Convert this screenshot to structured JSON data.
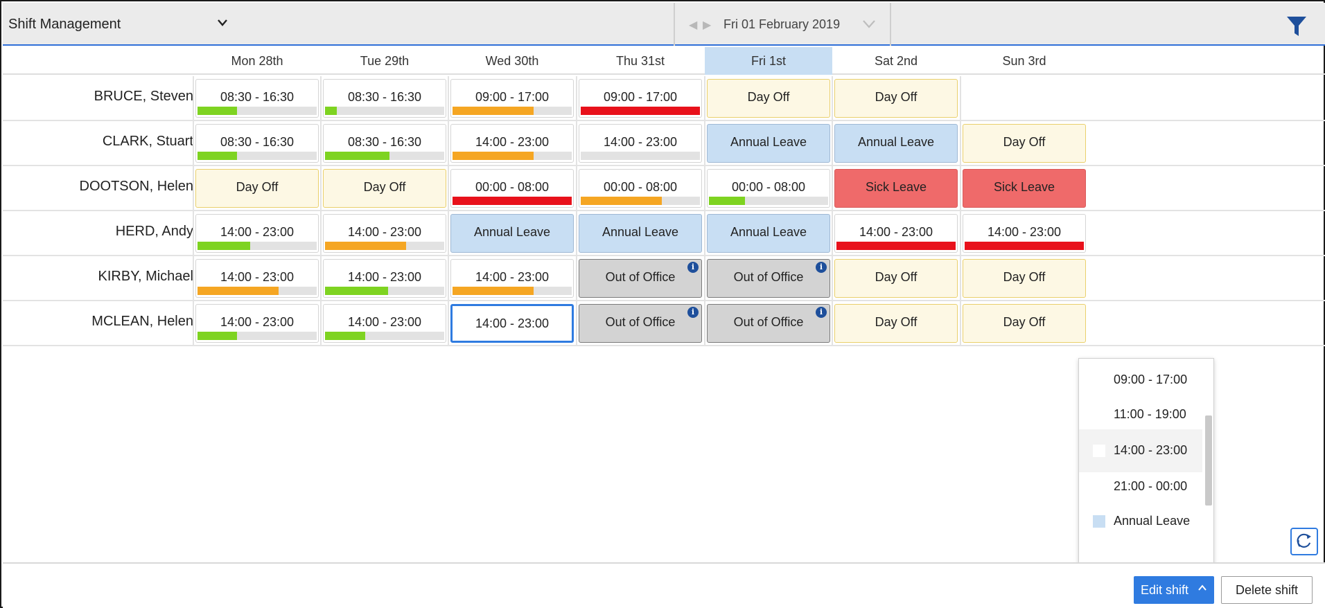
{
  "header": {
    "app_title": "Shift Management",
    "date": "Fri 01 February 2019"
  },
  "colors": {
    "accent": "#2f7be0",
    "dayoff_bg": "#fdf8e4",
    "annual_bg": "#c8def3",
    "sick_bg": "#ef6a6a",
    "ooo_bg": "#d3d3d3",
    "progress_green": "#7ed321",
    "progress_orange": "#f5a623",
    "progress_red": "#e8111b"
  },
  "days": [
    "Mon 28th",
    "Tue 29th",
    "Wed 30th",
    "Thu 31st",
    "Fri 1st",
    "Sat 2nd",
    "Sun 3rd"
  ],
  "today_index": 4,
  "rows": [
    {
      "name": "BRUCE, Steven",
      "cells": [
        {
          "type": "shift",
          "label": "08:30 - 16:30",
          "progress": 0.33,
          "color": "green"
        },
        {
          "type": "shift",
          "label": "08:30 - 16:30",
          "progress": 0.1,
          "color": "green"
        },
        {
          "type": "shift",
          "label": "09:00 - 17:00",
          "progress": 0.68,
          "color": "orange"
        },
        {
          "type": "shift",
          "label": "09:00 - 17:00",
          "progress": 1.0,
          "color": "red"
        },
        {
          "type": "dayoff",
          "label": "Day Off"
        },
        {
          "type": "dayoff",
          "label": "Day Off"
        },
        {
          "type": "empty",
          "label": ""
        }
      ]
    },
    {
      "name": "CLARK, Stuart",
      "cells": [
        {
          "type": "shift",
          "label": "08:30 - 16:30",
          "progress": 0.33,
          "color": "green"
        },
        {
          "type": "shift",
          "label": "08:30 - 16:30",
          "progress": 0.54,
          "color": "green"
        },
        {
          "type": "shift",
          "label": "14:00 - 23:00",
          "progress": 0.68,
          "color": "orange"
        },
        {
          "type": "shift",
          "label": "14:00 - 23:00",
          "progress": 0.0,
          "color": "green"
        },
        {
          "type": "annual",
          "label": "Annual Leave"
        },
        {
          "type": "annual",
          "label": "Annual Leave"
        },
        {
          "type": "dayoff",
          "label": "Day Off"
        }
      ]
    },
    {
      "name": "DOOTSON, Helen",
      "cells": [
        {
          "type": "dayoff",
          "label": "Day Off"
        },
        {
          "type": "dayoff",
          "label": "Day Off"
        },
        {
          "type": "shift",
          "label": "00:00 - 08:00",
          "progress": 1.0,
          "color": "red"
        },
        {
          "type": "shift",
          "label": "00:00 - 08:00",
          "progress": 0.68,
          "color": "orange"
        },
        {
          "type": "shift",
          "label": "00:00 - 08:00",
          "progress": 0.3,
          "color": "green"
        },
        {
          "type": "sick",
          "label": "Sick Leave"
        },
        {
          "type": "sick",
          "label": "Sick Leave"
        }
      ]
    },
    {
      "name": "HERD, Andy",
      "cells": [
        {
          "type": "shift",
          "label": "14:00 - 23:00",
          "progress": 0.44,
          "color": "green"
        },
        {
          "type": "shift",
          "label": "14:00 - 23:00",
          "progress": 0.68,
          "color": "orange"
        },
        {
          "type": "annual",
          "label": "Annual Leave"
        },
        {
          "type": "annual",
          "label": "Annual Leave"
        },
        {
          "type": "annual",
          "label": "Annual Leave"
        },
        {
          "type": "shift",
          "label": "14:00 - 23:00",
          "progress": 1.0,
          "color": "red"
        },
        {
          "type": "shift",
          "label": "14:00 - 23:00",
          "progress": 1.0,
          "color": "red"
        }
      ]
    },
    {
      "name": "KIRBY, Michael",
      "cells": [
        {
          "type": "shift",
          "label": "14:00 - 23:00",
          "progress": 0.68,
          "color": "orange"
        },
        {
          "type": "shift",
          "label": "14:00 - 23:00",
          "progress": 0.53,
          "color": "green"
        },
        {
          "type": "shift",
          "label": "14:00 - 23:00",
          "progress": 0.68,
          "color": "orange"
        },
        {
          "type": "ooo",
          "label": "Out of Office",
          "info": "i"
        },
        {
          "type": "ooo",
          "label": "Out of Office",
          "info": "i"
        },
        {
          "type": "dayoff",
          "label": "Day Off"
        },
        {
          "type": "dayoff",
          "label": "Day Off"
        }
      ]
    },
    {
      "name": "MCLEAN, Helen",
      "cells": [
        {
          "type": "shift",
          "label": "14:00 - 23:00",
          "progress": 0.33,
          "color": "green"
        },
        {
          "type": "shift",
          "label": "14:00 - 23:00",
          "progress": 0.34,
          "color": "green"
        },
        {
          "type": "shift",
          "label": "14:00 - 23:00",
          "selected": true
        },
        {
          "type": "ooo",
          "label": "Out of Office",
          "info": "i"
        },
        {
          "type": "ooo",
          "label": "Out of Office",
          "info": "i"
        },
        {
          "type": "dayoff",
          "label": "Day Off"
        },
        {
          "type": "dayoff",
          "label": "Day Off"
        }
      ]
    }
  ],
  "dropdown": {
    "options": [
      {
        "label": "09:00 - 17:00",
        "swatch": ""
      },
      {
        "label": "11:00 - 19:00",
        "swatch": ""
      },
      {
        "label": "14:00 - 23:00",
        "swatch": "#ffffff",
        "highlighted": true
      },
      {
        "label": "21:00 - 00:00",
        "swatch": ""
      },
      {
        "label": "Annual Leave",
        "swatch": "#c8def3"
      }
    ]
  },
  "footer": {
    "edit_label": "Edit shift",
    "delete_label": "Delete shift"
  },
  "icons": {
    "app_menu": "chevron-down-icon",
    "filter": "filter-icon",
    "refresh": "refresh-icon",
    "row_menu": "kebab-menu-icon",
    "info": "info-icon"
  }
}
